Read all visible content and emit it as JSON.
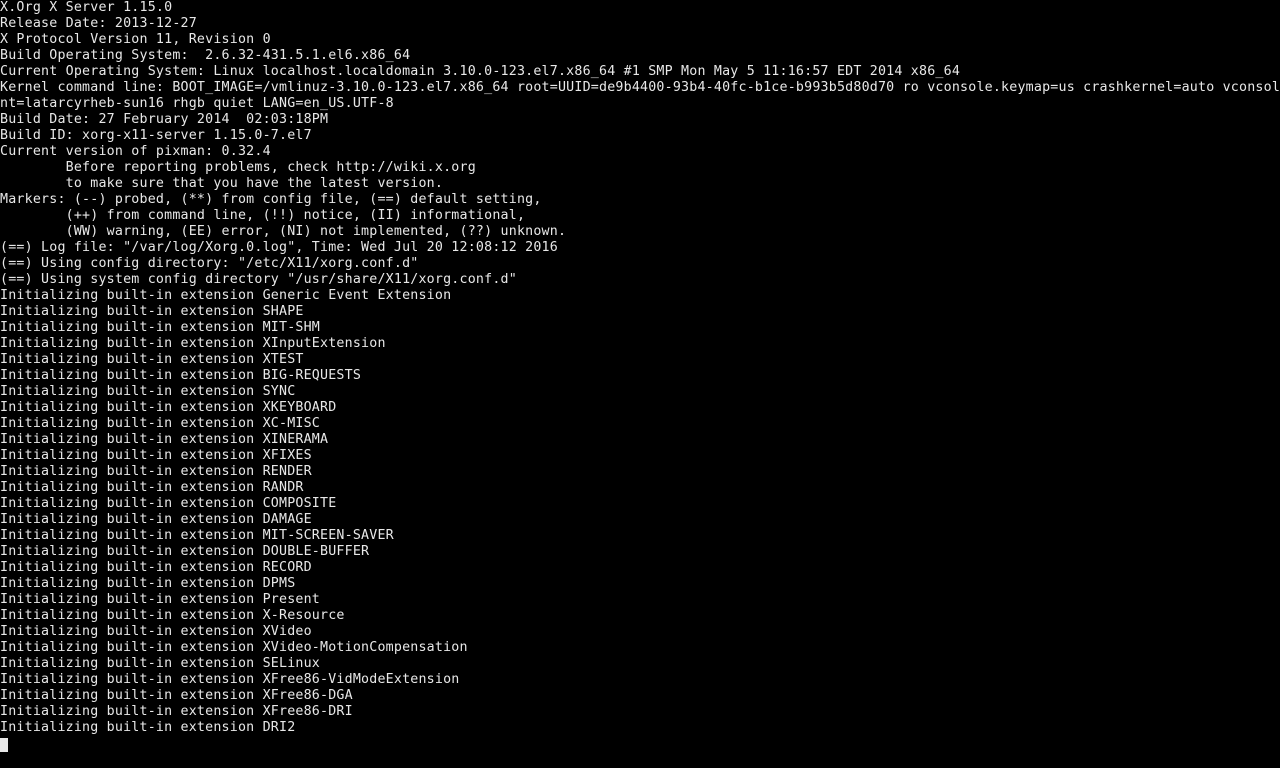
{
  "header": {
    "server": "X.Org X Server 1.15.0",
    "release_date": "Release Date: 2013-12-27",
    "protocol": "X Protocol Version 11, Revision 0",
    "build_os": "Build Operating System:  2.6.32-431.5.1.el6.x86_64",
    "current_os": "Current Operating System: Linux localhost.localdomain 3.10.0-123.el7.x86_64 #1 SMP Mon May 5 11:16:57 EDT 2014 x86_64",
    "kernel_cmd_line1": "Kernel command line: BOOT_IMAGE=/vmlinuz-3.10.0-123.el7.x86_64 root=UUID=de9b4400-93b4-40fc-b1ce-b993b5d80d70 ro vconsole.keymap=us crashkernel=auto vconsole.fo",
    "kernel_cmd_line2": "nt=latarcyrheb-sun16 rhgb quiet LANG=en_US.UTF-8",
    "build_date": "Build Date: 27 February 2014  02:03:18PM",
    "build_id": "Build ID: xorg-x11-server 1.15.0-7.el7",
    "pixman": "Current version of pixman: 0.32.4",
    "advice1": "        Before reporting problems, check http://wiki.x.org",
    "advice2": "        to make sure that you have the latest version.",
    "markers1": "Markers: (--) probed, (**) from config file, (==) default setting,",
    "markers2": "        (++) from command line, (!!) notice, (II) informational,",
    "markers3": "        (WW) warning, (EE) error, (NI) not implemented, (??) unknown.",
    "logfile": "(==) Log file: \"/var/log/Xorg.0.log\", Time: Wed Jul 20 12:08:12 2016",
    "config_dir": "(==) Using config directory: \"/etc/X11/xorg.conf.d\"",
    "sys_config_dir": "(==) Using system config directory \"/usr/share/X11/xorg.conf.d\""
  },
  "ext_prefix": "Initializing built-in extension ",
  "extensions": [
    "Generic Event Extension",
    "SHAPE",
    "MIT-SHM",
    "XInputExtension",
    "XTEST",
    "BIG-REQUESTS",
    "SYNC",
    "XKEYBOARD",
    "XC-MISC",
    "XINERAMA",
    "XFIXES",
    "RENDER",
    "RANDR",
    "COMPOSITE",
    "DAMAGE",
    "MIT-SCREEN-SAVER",
    "DOUBLE-BUFFER",
    "RECORD",
    "DPMS",
    "Present",
    "X-Resource",
    "XVideo",
    "XVideo-MotionCompensation",
    "SELinux",
    "XFree86-VidModeExtension",
    "XFree86-DGA",
    "XFree86-DRI",
    "DRI2"
  ]
}
